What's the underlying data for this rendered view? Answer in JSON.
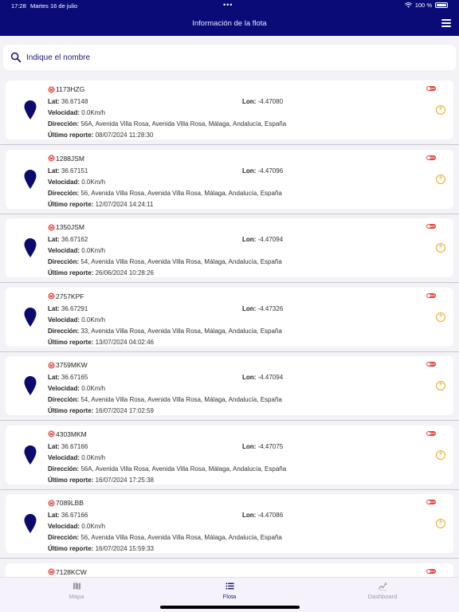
{
  "status_bar": {
    "time": "17:28",
    "date": "Martes 16 de julio",
    "battery": "100 %"
  },
  "header": {
    "title": "Información de la flota"
  },
  "search": {
    "placeholder": "Indique el nombre"
  },
  "labels": {
    "lat": "Lat:",
    "lon": "Lon:",
    "speed": "Velocidad:",
    "address": "Dirección:",
    "last_report": "Último reporte:",
    "toggle": "OFF"
  },
  "vehicles": [
    {
      "plate": "1173HZG",
      "lat": "36.67148",
      "lon": "-4.47080",
      "speed": "0.0Km/h",
      "address": "56A, Avenida Villa Rosa, Avenida Villa Rosa, Málaga, Andalucía, España",
      "last_report": "08/07/2024 11:28:30"
    },
    {
      "plate": "1288JSM",
      "lat": "36.67151",
      "lon": "-4.47096",
      "speed": "0.0Km/h",
      "address": "56, Avenida Villa Rosa, Avenida Villa Rosa, Málaga, Andalucía, España",
      "last_report": "12/07/2024 14:24:11"
    },
    {
      "plate": "1350JSM",
      "lat": "36.67162",
      "lon": "-4.47094",
      "speed": "0.0Km/h",
      "address": "54, Avenida Villa Rosa, Avenida Villa Rosa, Málaga, Andalucía, España",
      "last_report": "26/06/2024 10:28:26"
    },
    {
      "plate": "2757KPF",
      "lat": "36.67291",
      "lon": "-4.47326",
      "speed": "0.0Km/h",
      "address": "33, Avenida Villa Rosa, Avenida Villa Rosa, Málaga, Andalucía, España",
      "last_report": "13/07/2024 04:02:46"
    },
    {
      "plate": "3759MKW",
      "lat": "36.67165",
      "lon": "-4.47094",
      "speed": "0.0Km/h",
      "address": "54, Avenida Villa Rosa, Avenida Villa Rosa, Málaga, Andalucía, España",
      "last_report": "16/07/2024 17:02:59"
    },
    {
      "plate": "4303MKM",
      "lat": "36.67166",
      "lon": "-4.47075",
      "speed": "0.0Km/h",
      "address": "56A, Avenida Villa Rosa, Avenida Villa Rosa, Málaga, Andalucía, España",
      "last_report": "16/07/2024 17:25:38"
    },
    {
      "plate": "7089LBB",
      "lat": "36.67166",
      "lon": "-4.47086",
      "speed": "0.0Km/h",
      "address": "56, Avenida Villa Rosa, Avenida Villa Rosa, Málaga, Andalucía, España",
      "last_report": "16/07/2024 15:59:33"
    },
    {
      "plate": "7128KCW",
      "lat": "",
      "lon": "",
      "speed": "",
      "address": "",
      "last_report": ""
    }
  ],
  "tabs": [
    {
      "label": "Mapa",
      "icon": "map-icon",
      "active": false
    },
    {
      "label": "Flota",
      "icon": "list-icon",
      "active": true
    },
    {
      "label": "Dashboard",
      "icon": "chart-icon",
      "active": false
    }
  ],
  "colors": {
    "header_bg": "#0b0b78",
    "pin": "#0b0b6e",
    "status_off": "#e8453c",
    "add_icon": "#f2a922",
    "active_tab": "#1a1a6e"
  }
}
